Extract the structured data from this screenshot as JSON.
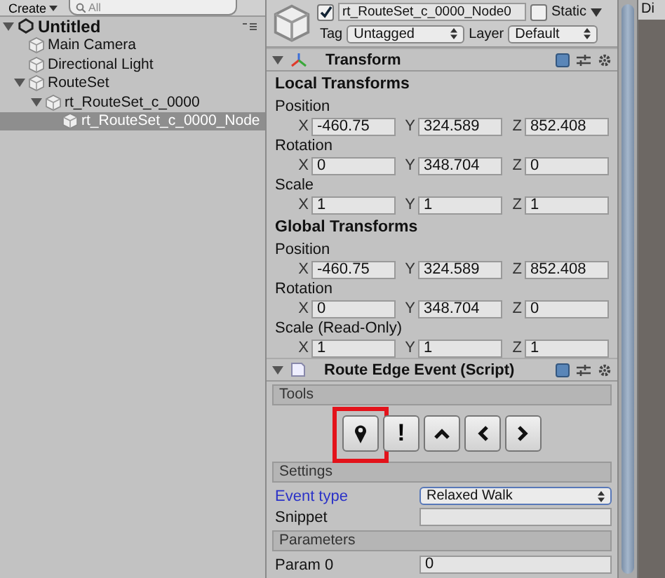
{
  "hierarchy": {
    "create_button": "Create",
    "search": {
      "placeholder": "All"
    },
    "scene": {
      "title": "Untitled",
      "expanded": true
    },
    "items": [
      {
        "label": "Main Camera",
        "selected": false
      },
      {
        "label": "Directional Light",
        "selected": false
      },
      {
        "label": "RouteSet",
        "selected": false,
        "expanded": true,
        "children": [
          {
            "label": "rt_RouteSet_c_0000",
            "selected": false,
            "expanded": true,
            "children": [
              {
                "label": "rt_RouteSet_c_0000_Node",
                "selected": true
              }
            ]
          }
        ]
      }
    ]
  },
  "inspector": {
    "object": {
      "active": true,
      "name": "rt_RouteSet_c_0000_Node0",
      "static": false,
      "static_label": "Static",
      "tag_label": "Tag",
      "tag": "Untagged",
      "layer_label": "Layer",
      "layer": "Default"
    },
    "components": [
      {
        "kind": "transform",
        "title": "Transform",
        "expanded": true,
        "groups": [
          {
            "title": "Local Transforms",
            "rows": [
              {
                "label": "Position",
                "fields": [
                  {
                    "axis": "X",
                    "value": "-460.75"
                  },
                  {
                    "axis": "Y",
                    "value": "324.589"
                  },
                  {
                    "axis": "Z",
                    "value": "852.408"
                  }
                ]
              },
              {
                "label": "Rotation",
                "fields": [
                  {
                    "axis": "X",
                    "value": "0"
                  },
                  {
                    "axis": "Y",
                    "value": "348.704"
                  },
                  {
                    "axis": "Z",
                    "value": "0"
                  }
                ]
              },
              {
                "label": "Scale",
                "fields": [
                  {
                    "axis": "X",
                    "value": "1"
                  },
                  {
                    "axis": "Y",
                    "value": "1"
                  },
                  {
                    "axis": "Z",
                    "value": "1"
                  }
                ]
              }
            ]
          },
          {
            "title": "Global Transforms",
            "rows": [
              {
                "label": "Position",
                "fields": [
                  {
                    "axis": "X",
                    "value": "-460.75"
                  },
                  {
                    "axis": "Y",
                    "value": "324.589"
                  },
                  {
                    "axis": "Z",
                    "value": "852.408"
                  }
                ]
              },
              {
                "label": "Rotation",
                "fields": [
                  {
                    "axis": "X",
                    "value": "0"
                  },
                  {
                    "axis": "Y",
                    "value": "348.704"
                  },
                  {
                    "axis": "Z",
                    "value": "0"
                  }
                ]
              },
              {
                "label": "Scale (Read-Only)",
                "fields": [
                  {
                    "axis": "X",
                    "value": "1"
                  },
                  {
                    "axis": "Y",
                    "value": "1"
                  },
                  {
                    "axis": "Z",
                    "value": "1"
                  }
                ]
              }
            ]
          }
        ]
      },
      {
        "kind": "script",
        "title": "Route Edge Event (Script)",
        "expanded": true,
        "sections": [
          {
            "title": "Tools",
            "tools": [
              {
                "kind": "pin",
                "highlighted": true
              },
              {
                "kind": "text",
                "label": "!",
                "highlighted": false
              },
              {
                "kind": "up",
                "highlighted": false
              },
              {
                "kind": "left",
                "highlighted": false
              },
              {
                "kind": "right",
                "highlighted": false
              }
            ]
          },
          {
            "title": "Settings",
            "fields": [
              {
                "label": "Event type",
                "kind": "dropdown",
                "value": "Relaxed Walk",
                "modified": true
              },
              {
                "label": "Snippet",
                "kind": "text",
                "modified": false
              }
            ]
          },
          {
            "title": "Parameters",
            "fields": [
              {
                "label": "Param 0",
                "kind": "text",
                "value": "0",
                "modified": false
              }
            ]
          }
        ]
      }
    ]
  },
  "side_tab": {
    "label": "Di"
  }
}
